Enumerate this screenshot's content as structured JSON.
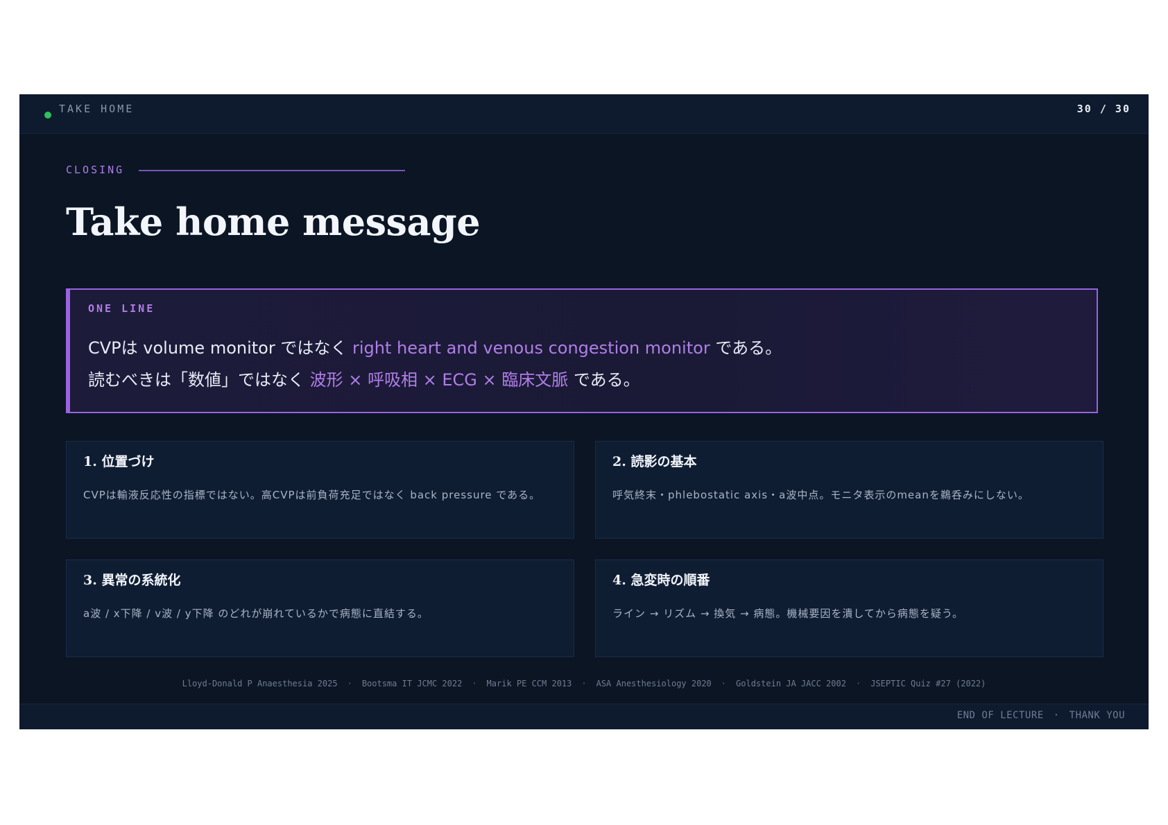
{
  "header": {
    "section": "TAKE HOME",
    "page": "30 / 30",
    "status_color": "#2bc25b"
  },
  "eyebrow": "CLOSING",
  "title": "Take home message",
  "one_line": {
    "label": "ONE LINE",
    "line1": {
      "prefix": "CVPは volume monitor ではなく ",
      "accent": "right heart and venous congestion monitor",
      "suffix": " である。"
    },
    "line2": {
      "prefix": "読むべきは「数値」ではなく ",
      "accent": "波形 × 呼吸相 × ECG × 臨床文脈",
      "suffix": " である。"
    }
  },
  "cards": [
    {
      "title": "1. 位置づけ",
      "body": "CVPは輸液反応性の指標ではない。高CVPは前負荷充足ではなく back pressure である。"
    },
    {
      "title": "2. 読影の基本",
      "body": "呼気終末・phlebostatic axis・a波中点。モニタ表示のmeanを鵜呑みにしない。"
    },
    {
      "title": "3. 異常の系統化",
      "body": "a波 / x下降 / v波 / y下降 のどれが崩れているかで病態に直結する。"
    },
    {
      "title": "4. 急変時の順番",
      "body": "ライン → リズム → 換気 → 病態。機械要因を潰してから病態を疑う。"
    }
  ],
  "references": [
    "Lloyd-Donald P Anaesthesia 2025",
    "Bootsma IT JCMC 2022",
    "Marik PE CCM 2013",
    "ASA Anesthesiology 2020",
    "Goldstein JA JACC 2002",
    "JSEPTIC Quiz #27 (2022)"
  ],
  "reference_separator": "·",
  "footer": {
    "left": "END OF LECTURE",
    "separator": "·",
    "right": "THANK YOU"
  },
  "colors": {
    "background": "#0b1524",
    "accent": "#b07ee8",
    "card": "#0f1d33"
  }
}
